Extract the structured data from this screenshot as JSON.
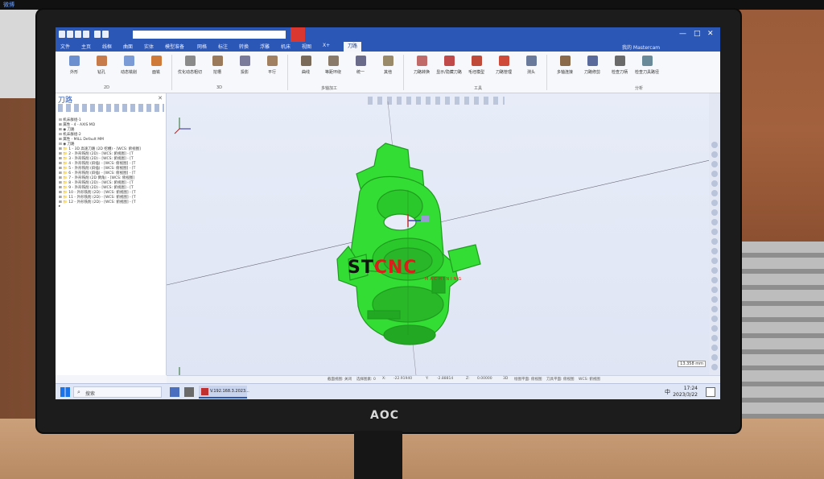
{
  "corner_label": "微博",
  "monitor": {
    "brand": "AOC"
  },
  "app": {
    "ribbon_tabs": [
      "文件",
      "主页",
      "线框",
      "曲面",
      "实体",
      "模型准备",
      "网格",
      "标注",
      "转换",
      "浮雕",
      "机床",
      "视图",
      "X+",
      "刀路"
    ],
    "active_tab": "刀路",
    "account_label": "我的 Mastercam",
    "ribbon_buttons": [
      {
        "label": "外形",
        "color": "#6b8fcf"
      },
      {
        "label": "钻孔",
        "color": "#c77b4a"
      },
      {
        "label": "动态铣削",
        "color": "#7a9bd6"
      },
      {
        "label": "面铣",
        "color": "#d07a3a"
      },
      {
        "label": "优化动态粗切",
        "color": "#8a8a8a"
      },
      {
        "label": "挖槽",
        "color": "#9a7a5a"
      },
      {
        "label": "投影",
        "color": "#7a7a9a"
      },
      {
        "label": "平行",
        "color": "#a08060"
      },
      {
        "label": "曲线",
        "color": "#7a6a5a"
      },
      {
        "label": "等距环绕",
        "color": "#8a7a6a"
      },
      {
        "label": "统一",
        "color": "#6a6a8a"
      },
      {
        "label": "其他",
        "color": "#9a8a6a"
      },
      {
        "label": "刀路转换",
        "color": "#c06a6a"
      },
      {
        "label": "显示/隐藏刀路",
        "color": "#c04a4a"
      },
      {
        "label": "毛坯模型",
        "color": "#c04a3a"
      },
      {
        "label": "刀路管理",
        "color": "#d04a3a"
      },
      {
        "label": "测头",
        "color": "#6a7a9a"
      },
      {
        "label": "多轴连接",
        "color": "#8a6a4a"
      },
      {
        "label": "刀路修剪",
        "color": "#5a6a9a"
      },
      {
        "label": "检查刀柄",
        "color": "#6a6a6a"
      },
      {
        "label": "检查刀具路径",
        "color": "#6a8a9a"
      }
    ],
    "ribbon_groups": [
      "2D",
      "3D",
      "多轴加工",
      "工具",
      "分析"
    ],
    "panel_title": "刀路",
    "tree_rows": [
      "⊟ 机床群组-1",
      "  ⊞ 属性 - 4 - AXIS MD",
      "  ⊞ ◉ 刀路",
      "⊟ 机床群组-2",
      "  ⊞ 属性 - MILL Default MM",
      "  ⊟ ◉ 刀路",
      "    ⊞ 📁 1 - 3D 高速刀路 (2D 挖槽) - [WCS: 俯视图]",
      "    ⊞ 📁 2 - 外形铣削 (2D) - [WCS: 俯视图] - [T",
      "    ⊞ 📁 3 - 外形铣削 (2D) - [WCS: 俯视图] - [T",
      "    ⊞ 📁 4 - 外形铣削 (斜插) - [WCS: 俯视图] - [T",
      "    ⊞ 📁 5 - 外形铣削 (斜插) - [WCS: 俯视图] - [T",
      "    ⊞ 📁 6 - 外形铣削 (斜插) - [WCS: 俯视图] - [T",
      "    ⊞ 📁 7 - 外形铣削 (2D 倒角) - [WCS: 俯视图]",
      "    ⊞ 📁 8 - 外形铣削 (2D) - [WCS: 俯视图] - [T",
      "    ⊞ 📁 9 - 外形铣削 (2D) - [WCS: 俯视图] - [T",
      "    ⊞ 📁 10 - 外形铣削 (2D) - [WCS: 俯视图] - [T",
      "    ⊞ 📁 11 - 外形铣削 (2D) - [WCS: 俯视图] - [T",
      "    ⊞ 📁 12 - 外形铣削 (2D) - [WCS: 俯视图] - [T",
      "    ▸"
    ],
    "status_items": [
      "截面视图: 关闭",
      "选择图素: 0",
      "X:",
      "-22.91940",
      "Y:",
      "-2.88814",
      "Z:",
      "0.00000",
      "3D",
      "绘图平面: 俯视图",
      "刀具平面: 俯视图",
      "WCS: 俯视图"
    ],
    "scale_label": "13.358 mm",
    "taskbar": {
      "search_label": "搜索",
      "app_label": "V.192.168.3.2023...",
      "lang": "中",
      "time": "17:24",
      "date": "2023/3/22"
    }
  },
  "overlay": {
    "brand_st": "ST",
    "brand_cnc": "CNC",
    "brand_sub": "MACHINING"
  },
  "colors": {
    "part": "#33dd33",
    "part_edge": "#1f9c1f",
    "titlebar": "#2b57b7",
    "accent_red": "#e01b1b"
  }
}
